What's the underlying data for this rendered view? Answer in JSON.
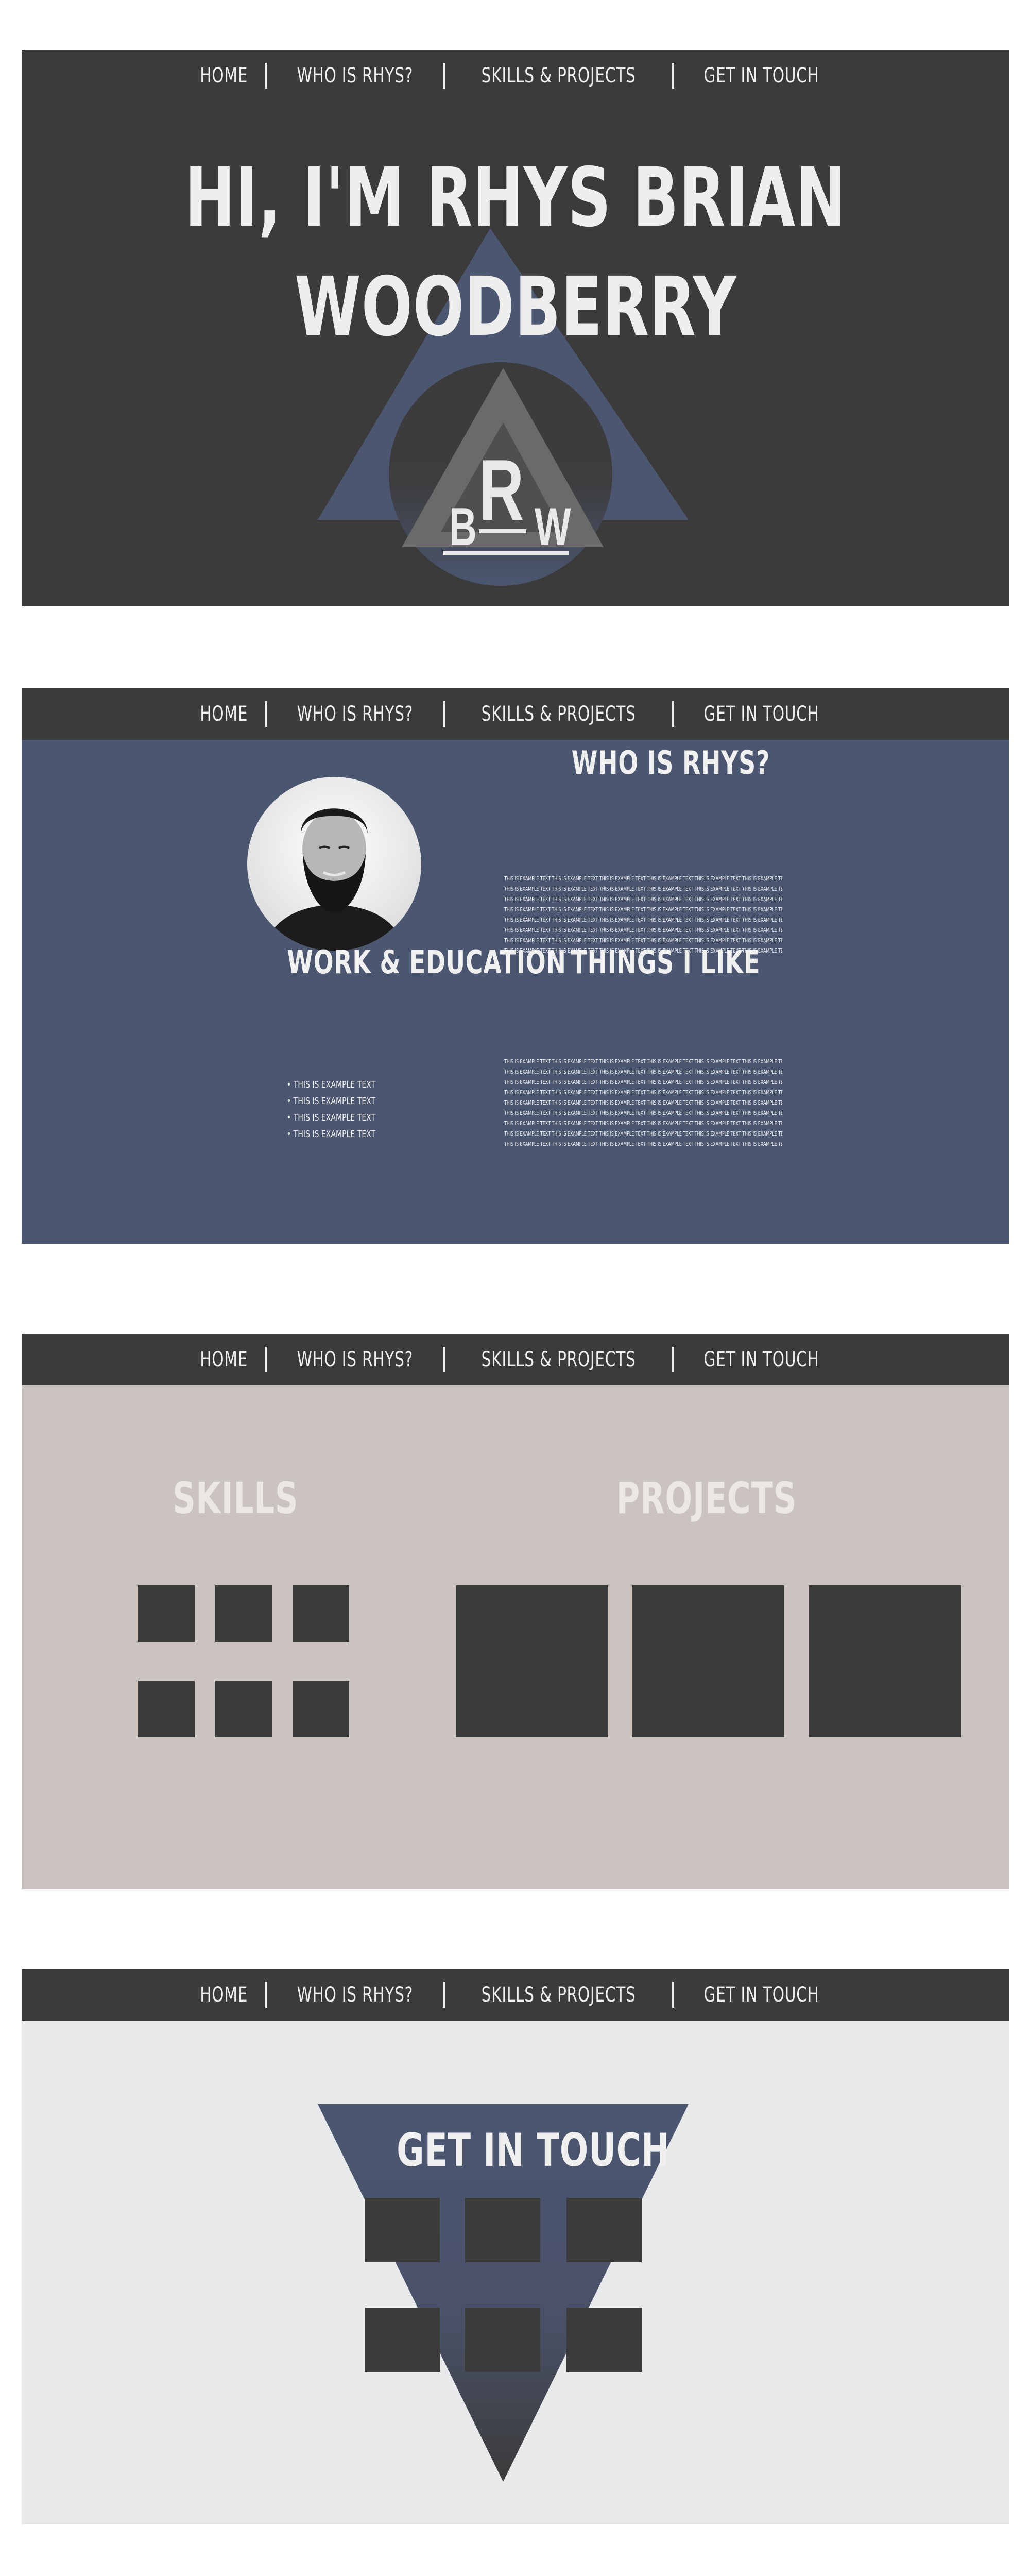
{
  "nav": {
    "items": [
      "HOME",
      "WHO IS RHYS?",
      "SKILLS & PROJECTS",
      "GET IN TOUCH"
    ]
  },
  "hero": {
    "line1": "HI, I'M RHYS BRIAN",
    "line2": "WOODBERRY",
    "logo_letters": {
      "left": "B",
      "center": "R",
      "right": "W"
    }
  },
  "about": {
    "who_title": "WHO IS RHYS?",
    "work_title": "WORK & EDUCATION",
    "likes_title": "THINGS I LIKE",
    "sample_line": "THIS IS EXAMPLE TEXT THIS IS EXAMPLE TEXT THIS IS EXAMPLE TEXT THIS IS EXAMPLE TEXT THIS IS EXAMPLE TEXT THIS IS EXAMPLE TEXT THIS IS EXAMPLE TEXT THIS IS EXAMPLE TEXT",
    "bullets": [
      "• THIS IS EXAMPLE TEXT",
      "• THIS IS EXAMPLE TEXT",
      "• THIS IS EXAMPLE TEXT",
      "• THIS IS EXAMPLE TEXT"
    ]
  },
  "skills_projects": {
    "skills_title": "SKILLS",
    "projects_title": "PROJECTS"
  },
  "contact": {
    "title": "GET IN TOUCH"
  },
  "colors": {
    "dark": "#3b3b3b",
    "navy": "#4b5670",
    "taupe": "#cbc3c0",
    "light_gray": "#e8e9ea",
    "text_light": "#eeeeee"
  }
}
